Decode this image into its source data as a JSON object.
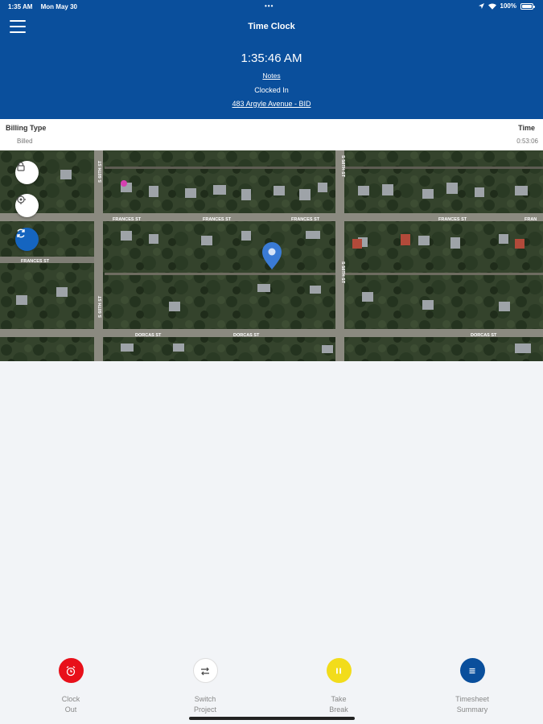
{
  "status_bar": {
    "time": "1:35 AM",
    "date": "Mon May 30",
    "dots": "•••",
    "battery": "100%"
  },
  "header": {
    "title": "Time Clock",
    "clock_time": "1:35:46 AM",
    "notes_label": "Notes",
    "status": "Clocked In",
    "address": "483 Argyle Avenue  - BID"
  },
  "billing": {
    "type_label": "Billing Type",
    "type_value": "Billed",
    "time_label": "Time",
    "time_value": "0:53:06"
  },
  "map": {
    "street_labels": [
      "S 60TH ST",
      "S 60TH ST",
      "FRANCES ST",
      "FRANCES ST",
      "FRANCES ST",
      "FRANCES ST",
      "FRANCES ST",
      "FRAN",
      "DORCAS ST",
      "DORCAS ST",
      "DORCAS ST",
      "S 58TH ST",
      "S 58TH ST"
    ],
    "buttons": [
      "lock-icon",
      "locate-icon",
      "refresh-icon"
    ]
  },
  "actions": [
    {
      "label_line1": "Clock",
      "label_line2": "Out",
      "color": "#e8101a",
      "icon": "alarm-clock-icon"
    },
    {
      "label_line1": "Switch",
      "label_line2": "Project",
      "color": "#ffffff",
      "icon": "swap-arrows-icon"
    },
    {
      "label_line1": "Take",
      "label_line2": "Break",
      "color": "#f2dc1b",
      "icon": "pause-icon"
    },
    {
      "label_line1": "Timesheet",
      "label_line2": "Summary",
      "color": "#0a4f9c",
      "icon": "list-icon"
    }
  ],
  "colors": {
    "header": "#0a4f9c",
    "map_pin": "#3a7bd5"
  }
}
